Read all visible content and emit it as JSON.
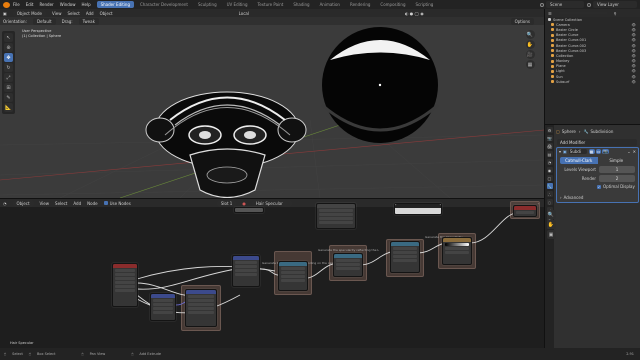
{
  "topbar": {
    "menus": [
      "File",
      "Edit",
      "Render",
      "Window",
      "Help"
    ],
    "workspaces": [
      "Shader Editing",
      "Character Development",
      "Sculpting",
      "UV Editing",
      "Texture Paint",
      "Shading",
      "Animation",
      "Rendering",
      "Compositing",
      "Scripting"
    ],
    "scene_label": "Scene",
    "view_layer_label": "View Layer"
  },
  "viewport": {
    "mode": "Object Mode",
    "menus": [
      "View",
      "Select",
      "Add",
      "Object"
    ],
    "orientation_label": "Orientation:",
    "orientation": "Default",
    "drag_label": "Drag:",
    "drag": "Tweak",
    "transform_space": "Local",
    "options_label": "Options",
    "overlay_title": "User Perspective",
    "overlay_subtitle": "(1) Collection | Sphere"
  },
  "outliner": {
    "title": "Scene Collection",
    "items": [
      "Camera",
      "Bezier Circle",
      "Bezier Curve",
      "Bezier Curve.001",
      "Bezier Curve.002",
      "Bezier Curve.003",
      "Collection",
      "Monkey",
      "Plane",
      "Light",
      "Sun",
      "Subsurf"
    ]
  },
  "properties": {
    "object_name": "Sphere",
    "modifier_name": "Subdivision",
    "add_modifier": "Add Modifier",
    "mod_short": "Subdi",
    "catmull": "Catmull-Clark",
    "simple": "Simple",
    "levels_viewport_label": "Levels Viewport",
    "levels_viewport": "1",
    "render_label": "Render",
    "render": "2",
    "optimal_display": "Optimal Display",
    "advanced": "Advanced"
  },
  "node_editor": {
    "editor": "Object",
    "menus": [
      "View",
      "Select",
      "Add",
      "Node"
    ],
    "use_nodes": "Use Nodes",
    "slot": "Slot 1",
    "material": "Hair Specular",
    "footer_label": "Hair Specular",
    "frame_labels": [
      "Generate the specularity depending on the camera",
      "Generate the specularity reflecting the L",
      "Generate the specularity"
    ]
  },
  "statusbar": {
    "items": [
      "Select",
      "Box Select",
      "Pan View",
      "Add Extrude"
    ],
    "version": "2.91"
  },
  "colors": {
    "accent": "#4772b3",
    "orange": "#e87d0d",
    "modifier_blue": "#4772b3"
  }
}
